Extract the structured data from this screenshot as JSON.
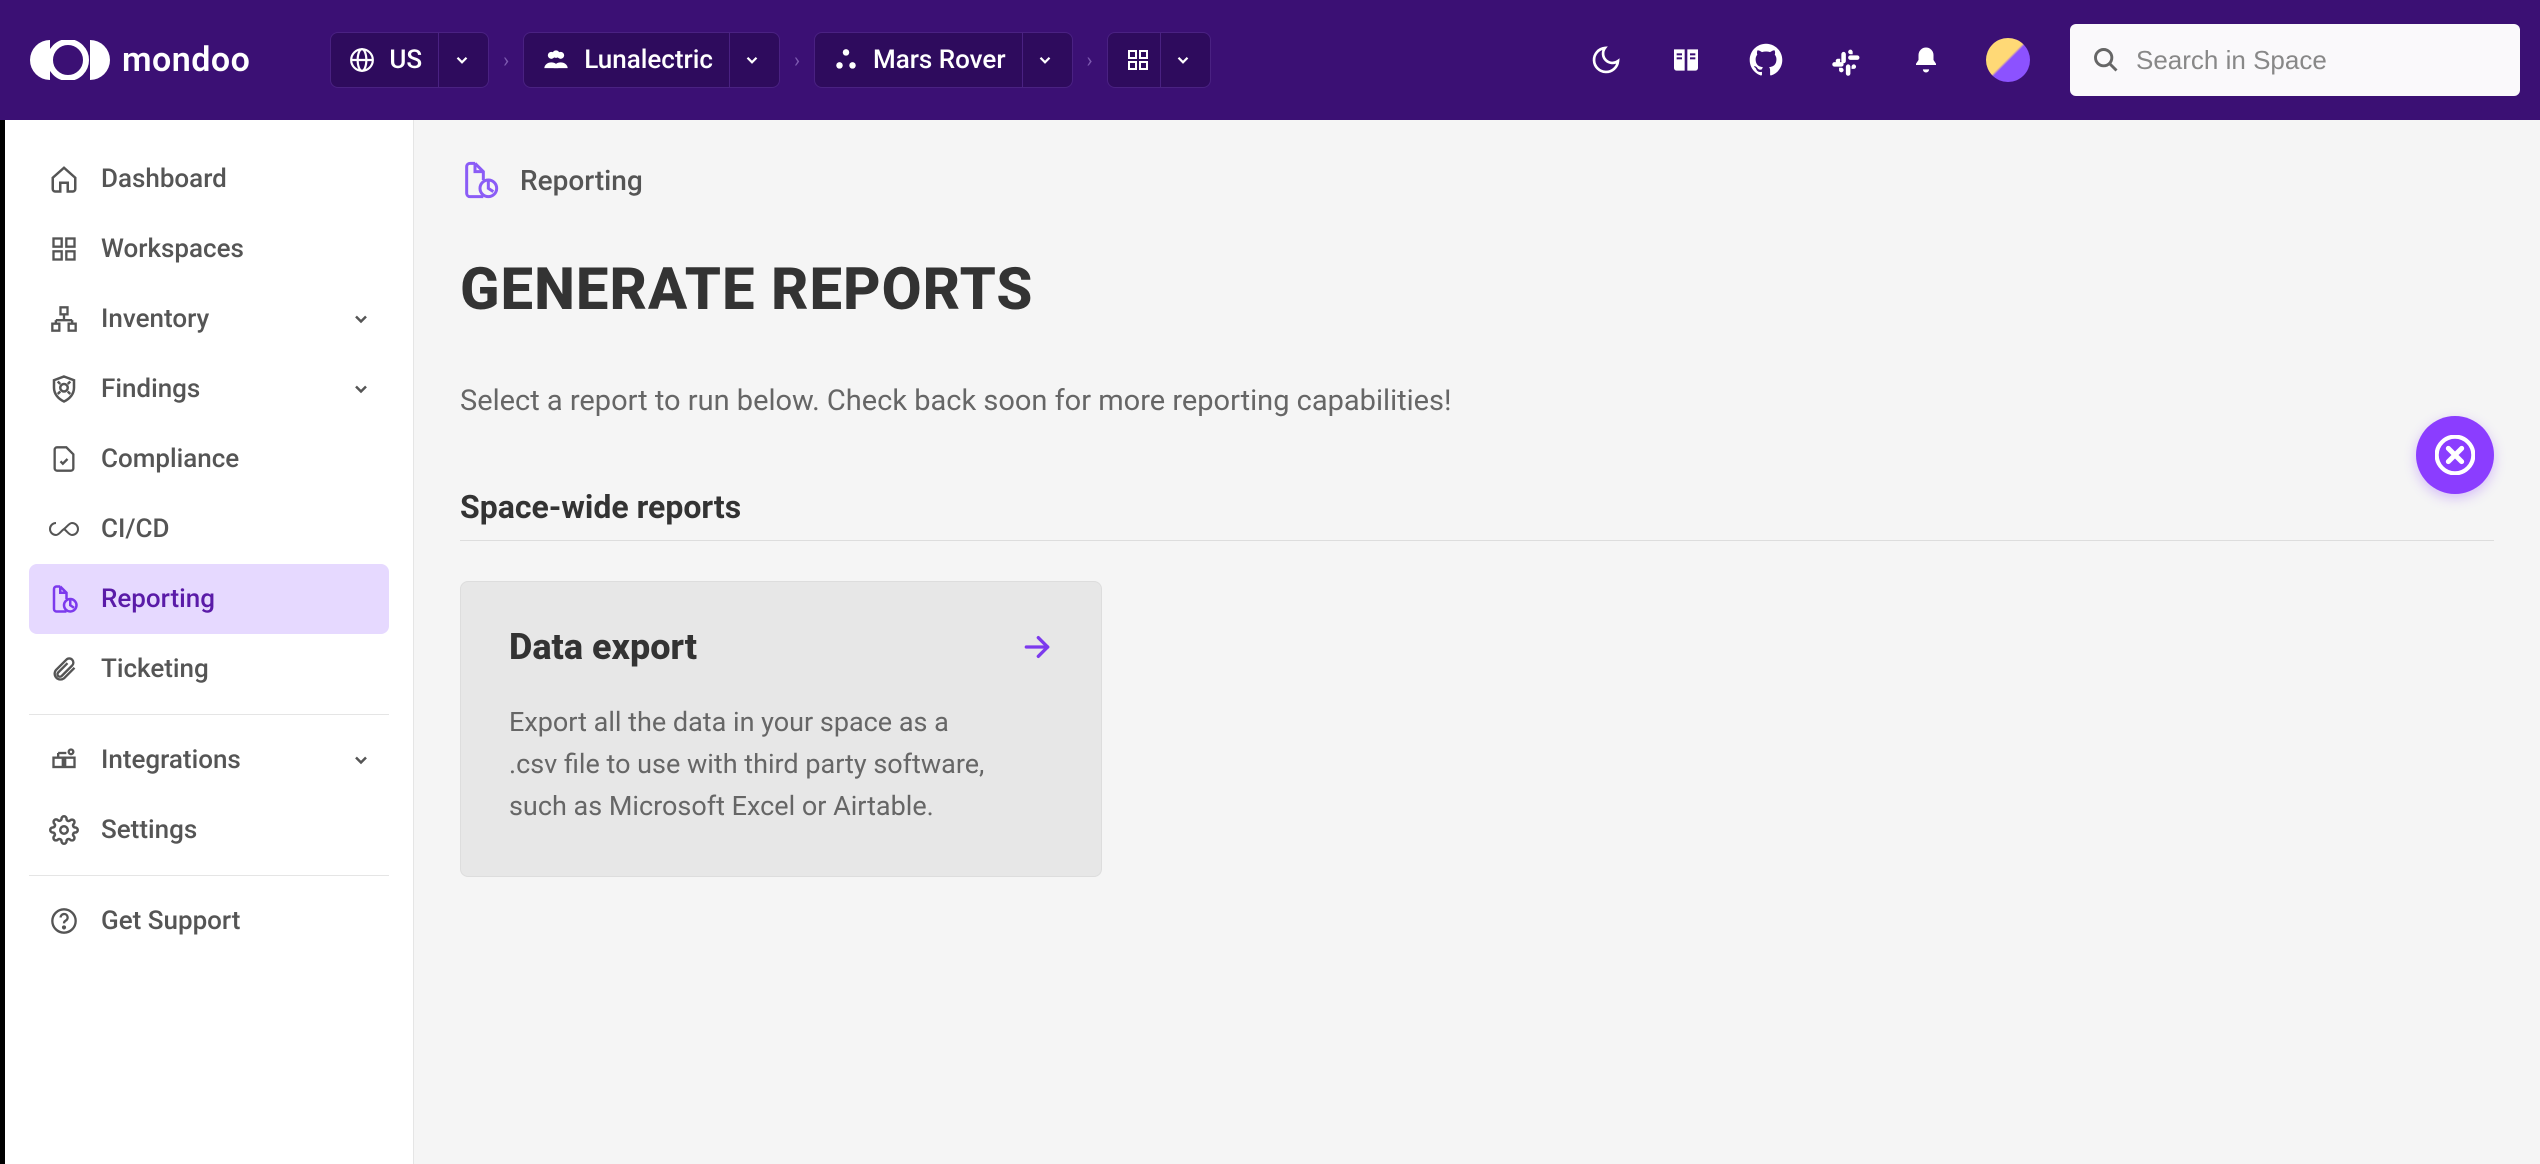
{
  "brand": {
    "name": "mondoo"
  },
  "header": {
    "crumbs": [
      {
        "label": "US"
      },
      {
        "label": "Lunalectric"
      },
      {
        "label": "Mars Rover"
      }
    ],
    "search_placeholder": "Search in Space"
  },
  "sidebar": {
    "items": {
      "dashboard": "Dashboard",
      "workspaces": "Workspaces",
      "inventory": "Inventory",
      "findings": "Findings",
      "compliance": "Compliance",
      "cicd": "CI/CD",
      "reporting": "Reporting",
      "ticketing": "Ticketing",
      "integrations": "Integrations",
      "settings": "Settings",
      "support": "Get Support"
    }
  },
  "main": {
    "breadcrumb": "Reporting",
    "title": "GENERATE REPORTS",
    "subtitle": "Select a report to run below. Check back soon for more reporting capabilities!",
    "section": "Space-wide reports",
    "card": {
      "title": "Data export",
      "body": "Export all the data in your space as a .csv file to use with third party software, such as Microsoft Excel or Airtable."
    }
  }
}
